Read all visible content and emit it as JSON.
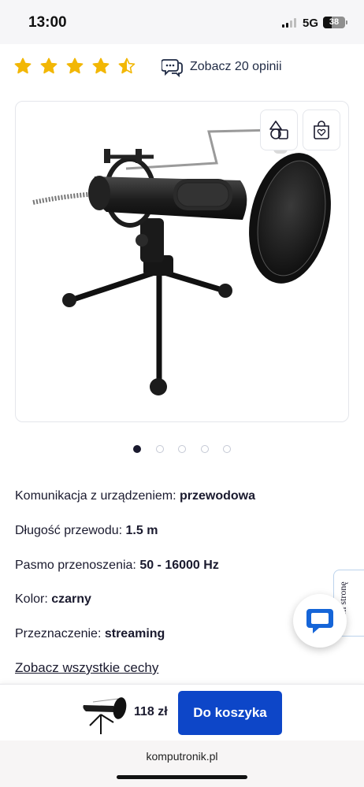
{
  "status": {
    "time": "13:00",
    "network": "5G",
    "battery": "38",
    "battery_level": 0.38
  },
  "rating": {
    "value": 4.5,
    "max": 5,
    "reviews_label": "Zobacz 20 opinii",
    "star_color": "#f2b705"
  },
  "product_card": {
    "compare_icon": "compare-shapes-icon",
    "wishlist_icon": "heart-bag-icon",
    "image": "usb-microphone-tripod-pop-filter"
  },
  "carousel": {
    "count": 5,
    "active_index": 0
  },
  "specs": [
    {
      "label": "Komunikacja z urządzeniem: ",
      "value": "przewodowa"
    },
    {
      "label": "Długość przewodu: ",
      "value": "1.5 m"
    },
    {
      "label": "Pasmo przenoszenia: ",
      "value": "50 - 16000 Hz"
    },
    {
      "label": "Kolor: ",
      "value": "czarny"
    },
    {
      "label": "Przeznaczenie: ",
      "value": "streaming"
    }
  ],
  "all_features_link": "Zobacz wszystkie cechy",
  "feedback_tab": "Oceń stronę",
  "chat_icon": "chat-bubble-icon",
  "bottom_bar": {
    "price": "118 zł",
    "add_to_cart": "Do koszyka",
    "button_color": "#0d46c8"
  },
  "browser": {
    "url": "komputronik.pl"
  }
}
